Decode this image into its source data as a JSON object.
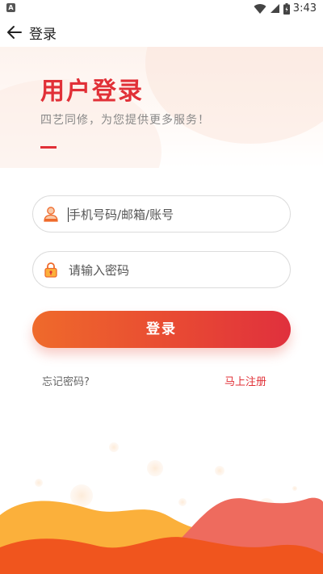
{
  "status_bar": {
    "time": "3:43",
    "notification_icon": "A",
    "icons": [
      "wifi-icon",
      "signal-icon",
      "battery-icon"
    ]
  },
  "app_bar": {
    "title": "登录",
    "back_icon": "arrow-left-icon"
  },
  "hero": {
    "heading": "用户登录",
    "subheading": "四艺同修，为您提供更多服务！"
  },
  "form": {
    "account_placeholder": "手机号码/邮箱/账号",
    "account_icon": "user-icon",
    "password_placeholder": "请输入密码",
    "password_icon": "lock-icon",
    "login_label": "登录",
    "forgot_label": "忘记密码?",
    "register_label": "马上注册"
  },
  "colors": {
    "accent": "#e13037",
    "button_start": "#ef6a2b",
    "button_end": "#e0303d",
    "wave_yellow": "#fbb03b",
    "wave_orange": "#f0551e",
    "wave_coral": "#ee6b5e"
  }
}
